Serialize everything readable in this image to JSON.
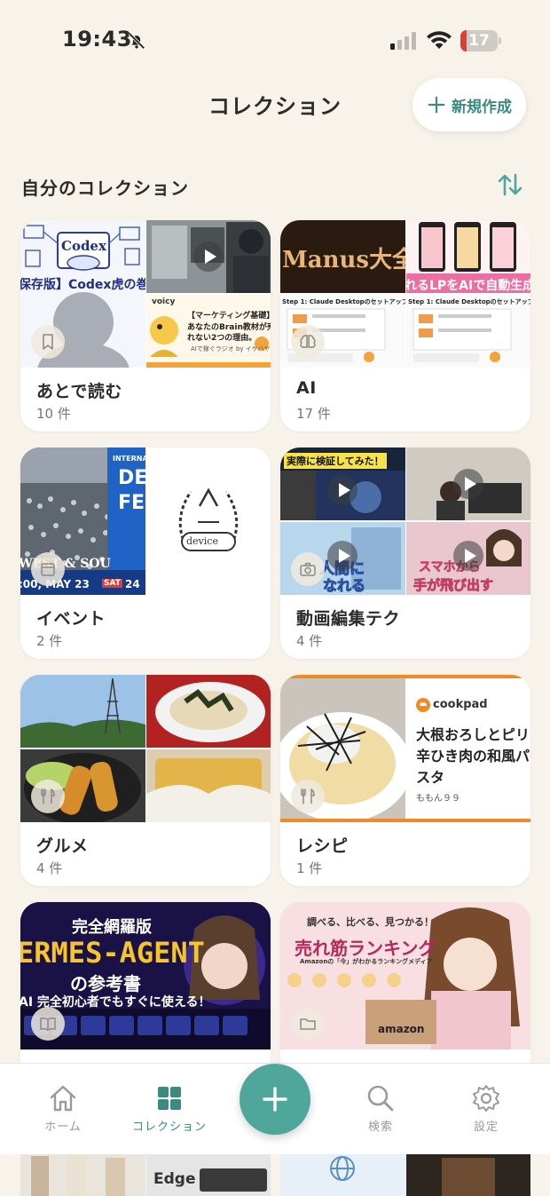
{
  "status_bar": {
    "time": "19:43",
    "battery": "17",
    "battery_percent": 17
  },
  "header": {
    "title": "コレクション",
    "new_button_label": "新規作成"
  },
  "section": {
    "title": "自分のコレクション"
  },
  "colors": {
    "accent": "#3d8a82",
    "fab": "#4fa69a",
    "background": "#f7f2ea",
    "battery_low": "#e33d32"
  },
  "collections": [
    {
      "name": "あとで読む",
      "count": "10 件",
      "badge_icon": "bookmark-icon",
      "thumbs": {
        "codex_tag": "Codex",
        "codex_title": "保存版】Codex虎の巻",
        "voicy": "voicy",
        "marketing_tag": "【マーケティング基礎】",
        "marketing_title_1": "あなたのBrain教材が売",
        "marketing_title_2": "れない2つの理由。",
        "marketing_sub": "AIで稼ぐラジオ by イケハヤ"
      }
    },
    {
      "name": "AI",
      "count": "17 件",
      "badge_icon": "brain-icon",
      "thumbs": {
        "manus": "Manus大全",
        "lp_ai": "れるLPをAIで自動生成",
        "step_1": "Step 1: Claude Desktopのセットアップ",
        "step_2": "Step 1: Claude Desktopのセットアップ"
      }
    },
    {
      "name": "イベント",
      "count": "2 件",
      "badge_icon": "calendar-icon",
      "thumbs": {
        "internal": "INTERNA",
        "de": "DE",
        "fe": "FE",
        "west": "WEST & SOU",
        "date": ":00, MAY 23",
        "sat": "SAT",
        "day24": "24",
        "device": "device"
      }
    },
    {
      "name": "動画編集テク",
      "count": "4 件",
      "badge_icon": "camera-icon",
      "thumbs": {
        "verify": "実際に検証してみた！",
        "ningen": "人間に",
        "nareru": "なれる",
        "sumaho": "スマホから",
        "tobidasu": "手が飛び出す"
      }
    },
    {
      "name": "グルメ",
      "count": "4 件",
      "badge_icon": "fork-knife-icon",
      "thumbs": {}
    },
    {
      "name": "レシピ",
      "count": "1 件",
      "badge_icon": "fork-knife-icon",
      "thumbs": {
        "cookpad": "cookpad",
        "recipe_1": "大根おろしとピリ",
        "recipe_2": "辛ひき肉の和風パ",
        "recipe_3": "スタ",
        "author": "ももん９９"
      }
    },
    {
      "name": "",
      "count": "",
      "badge_icon": "book-icon",
      "thumbs": {
        "kanzen": "完全網羅版",
        "hermes": "ERMES-AGENT",
        "sankosho": "の参考書",
        "beginner": "AI 完全初心者でもすぐに使える！"
      }
    },
    {
      "name": "",
      "count": "",
      "badge_icon": "folder-icon",
      "thumbs": {
        "shiraberu": "調べる、比べる、見つかる！",
        "ranking": "売れ筋ランキング",
        "ranking_sub": "Amazonの「今」がわかるランキングメディア",
        "amazon": "amazon"
      }
    }
  ],
  "peek": {
    "edge": "Edge"
  },
  "tabs": [
    {
      "label": "ホーム",
      "icon": "home-icon"
    },
    {
      "label": "コレクション",
      "icon": "grid-icon",
      "active": true
    },
    {
      "label": "検索",
      "icon": "search-icon"
    },
    {
      "label": "設定",
      "icon": "gear-icon"
    }
  ],
  "fab": {
    "icon": "plus-icon"
  }
}
